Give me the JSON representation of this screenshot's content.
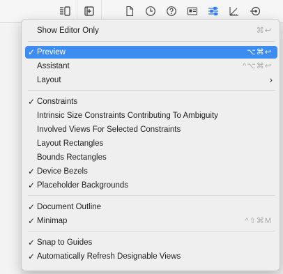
{
  "toolbar": {
    "icons": [
      "editor-options-icon",
      "add-editor-icon",
      "file-inspector-icon",
      "history-icon",
      "quick-help-icon",
      "identity-icon",
      "attributes-inspector-icon",
      "size-inspector-icon",
      "connections-icon"
    ]
  },
  "menu": {
    "show_editor_only": {
      "label": "Show Editor Only",
      "shortcut": "⌘↩"
    },
    "preview": {
      "label": "Preview",
      "shortcut": "⌥⌘↩",
      "checked": true
    },
    "assistant": {
      "label": "Assistant",
      "shortcut": "^⌥⌘↩"
    },
    "layout": {
      "label": "Layout"
    },
    "constraints": {
      "label": "Constraints",
      "checked": true
    },
    "intrinsic": {
      "label": "Intrinsic Size Constraints Contributing To Ambiguity"
    },
    "involved_views": {
      "label": "Involved Views For Selected Constraints"
    },
    "layout_rectangles": {
      "label": "Layout Rectangles"
    },
    "bounds_rectangles": {
      "label": "Bounds Rectangles"
    },
    "device_bezels": {
      "label": "Device Bezels",
      "checked": true
    },
    "placeholder_backgrounds": {
      "label": "Placeholder Backgrounds",
      "checked": true
    },
    "document_outline": {
      "label": "Document Outline",
      "checked": true
    },
    "minimap": {
      "label": "Minimap",
      "shortcut": "^⇧⌘M",
      "checked": true
    },
    "snap_to_guides": {
      "label": "Snap to Guides",
      "checked": true
    },
    "auto_refresh": {
      "label": "Automatically Refresh Designable Views",
      "checked": true
    },
    "check_glyph": "✓",
    "chevron_glyph": "›"
  },
  "colors": {
    "highlight": "#3d8cf0",
    "accent_icon": "#2f7cf6"
  }
}
